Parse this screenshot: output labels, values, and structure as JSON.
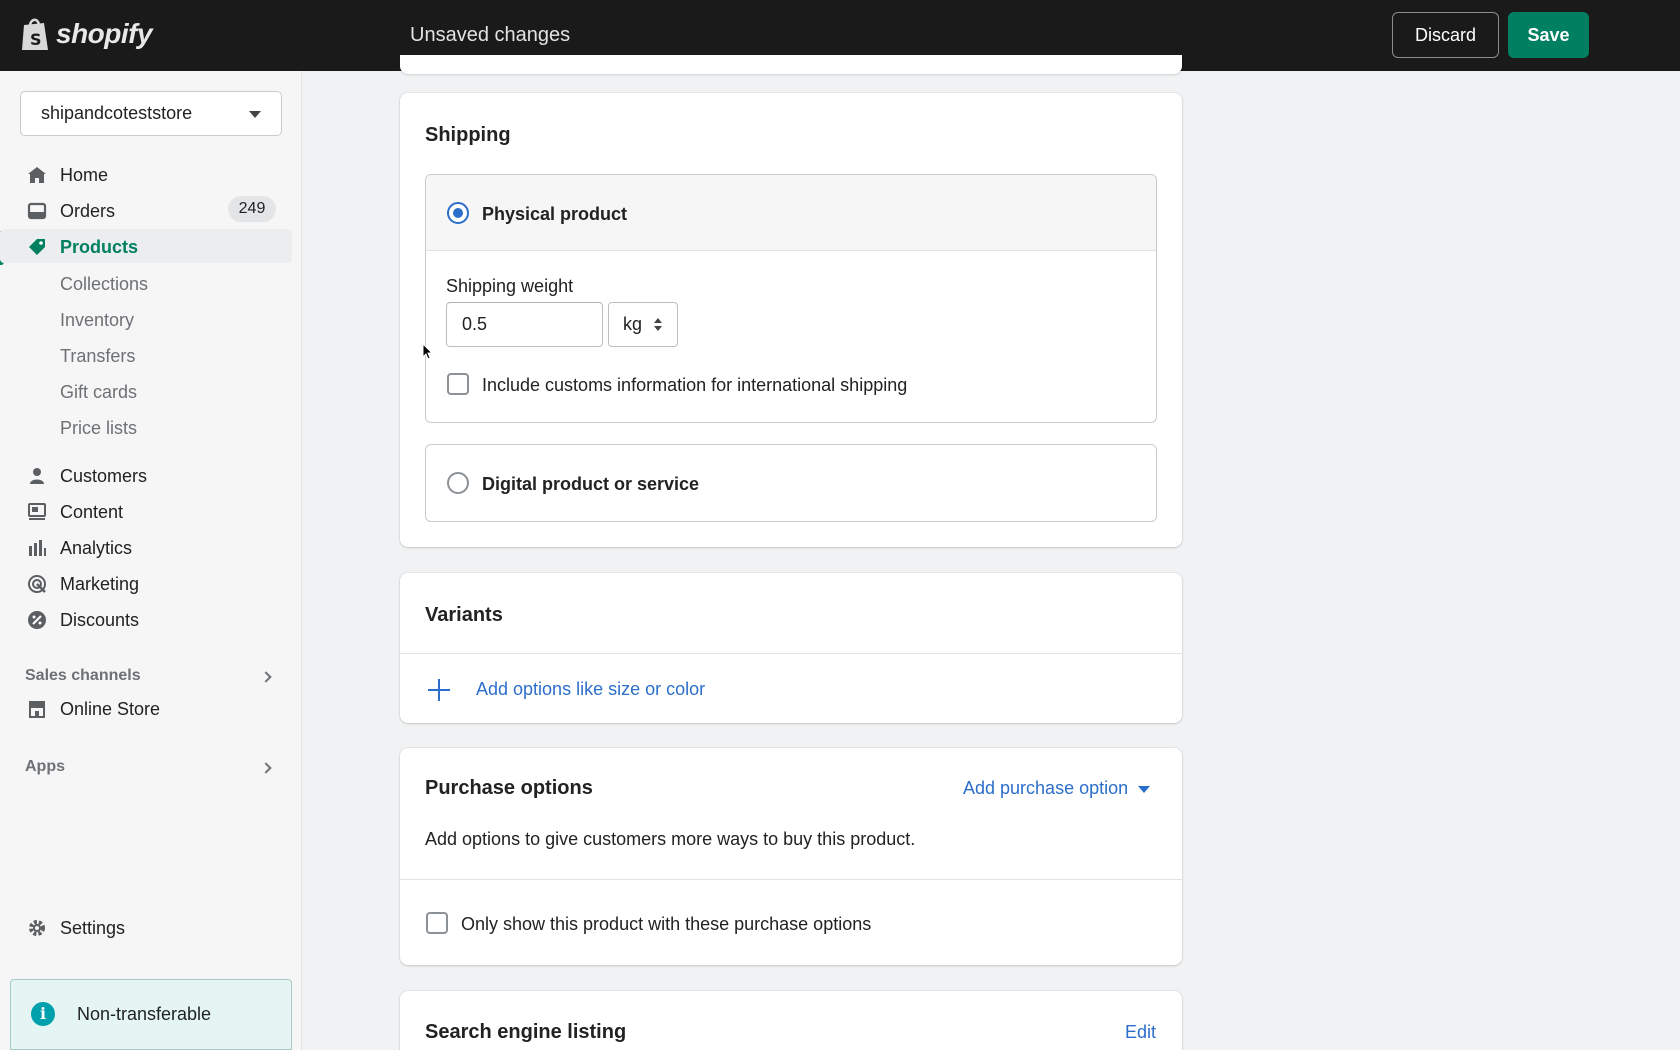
{
  "topbar": {
    "logo_text": "shopify",
    "status": "Unsaved changes",
    "discard_label": "Discard",
    "save_label": "Save"
  },
  "sidebar": {
    "store_name": "shipandcoteststore",
    "items": [
      {
        "label": "Home",
        "icon": "home-icon"
      },
      {
        "label": "Orders",
        "icon": "orders-icon",
        "badge": "249"
      },
      {
        "label": "Products",
        "icon": "tag-icon",
        "active": true
      },
      {
        "label": "Customers",
        "icon": "person-icon"
      },
      {
        "label": "Content",
        "icon": "content-icon"
      },
      {
        "label": "Analytics",
        "icon": "bar-chart-icon"
      },
      {
        "label": "Marketing",
        "icon": "target-icon"
      },
      {
        "label": "Discounts",
        "icon": "discount-icon"
      }
    ],
    "product_subitems": [
      "Collections",
      "Inventory",
      "Transfers",
      "Gift cards",
      "Price lists"
    ],
    "sales_channels_label": "Sales channels",
    "online_store_label": "Online Store",
    "apps_label": "Apps",
    "settings_label": "Settings",
    "notice_text": "Non-transferable"
  },
  "shipping": {
    "title": "Shipping",
    "physical_label": "Physical product",
    "weight_label": "Shipping weight",
    "weight_value": "0.5",
    "weight_unit": "kg",
    "customs_label": "Include customs information for international shipping",
    "digital_label": "Digital product or service"
  },
  "variants": {
    "title": "Variants",
    "add_label": "Add options like size or color"
  },
  "purchase_options": {
    "title": "Purchase options",
    "add_link": "Add purchase option",
    "description": "Add options to give customers more ways to buy this product.",
    "only_show_label": "Only show this product with these purchase options"
  },
  "seo": {
    "title": "Search engine listing",
    "edit_label": "Edit"
  },
  "colors": {
    "brand_green": "#008060",
    "link_blue": "#2c6ecb",
    "topbar": "#1a1a1a"
  }
}
